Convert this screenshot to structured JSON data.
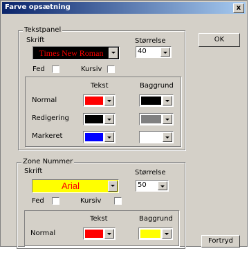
{
  "window": {
    "title": "Farve opsætning",
    "close_glyph": "x"
  },
  "buttons": {
    "ok": "OK",
    "cancel": "Fortryd"
  },
  "text_panel": {
    "group_label": "Tekstpanel",
    "font_label": "Skrift",
    "font_value": "Times New Roman",
    "size_label": "Størrelse",
    "size_value": "40",
    "bold_label": "Fed",
    "italic_label": "Kursiv",
    "col_text": "Tekst",
    "col_background": "Baggrund",
    "rows": [
      {
        "label": "Normal",
        "text_color": "#ff0000",
        "bg_color": "#000000"
      },
      {
        "label": "Redigering",
        "text_color": "#000000",
        "bg_color": "#808080"
      },
      {
        "label": "Markeret",
        "text_color": "#0000ff",
        "bg_color": "#ffffff"
      }
    ]
  },
  "zone_number": {
    "group_label": "Zone Nummer",
    "font_label": "Skrift",
    "font_value": "Arial",
    "size_label": "Størrelse",
    "size_value": "50",
    "bold_label": "Fed",
    "italic_label": "Kursiv",
    "col_text": "Tekst",
    "col_background": "Baggrund",
    "rows": [
      {
        "label": "Normal",
        "text_color": "#ff0000",
        "bg_color": "#ffff00"
      }
    ]
  },
  "colors": {
    "titlebar": "#0a246a",
    "face": "#d4d0c8",
    "font1_fg": "#ff0000",
    "font1_bg": "#000000",
    "font2_fg": "#ff0000",
    "font2_bg": "#ffff00"
  }
}
